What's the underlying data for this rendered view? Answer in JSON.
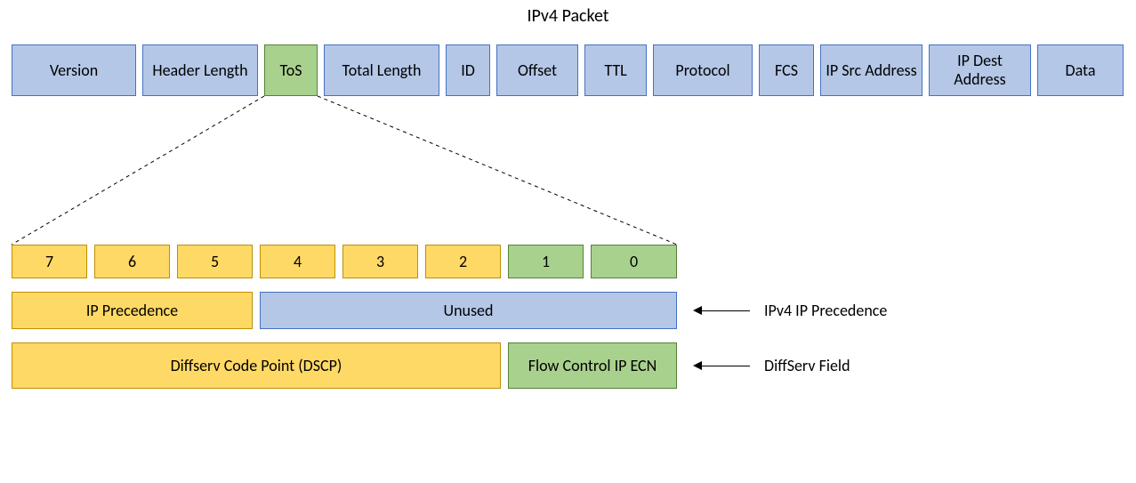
{
  "title": "IPv4 Packet",
  "header_fields": {
    "version": "Version",
    "header_length": "Header Length",
    "tos": "ToS",
    "total_length": "Total Length",
    "id": "ID",
    "offset": "Offset",
    "ttl": "TTL",
    "protocol": "Protocol",
    "fcs": "FCS",
    "ip_src_addr": "IP Src Address",
    "ip_dest_addr": "IP Dest Address",
    "data": "Data"
  },
  "bits": {
    "b7": "7",
    "b6": "6",
    "b5": "5",
    "b4": "4",
    "b3": "3",
    "b2": "2",
    "b1": "1",
    "b0": "0"
  },
  "precedence_row": {
    "ip_precedence": "IP Precedence",
    "unused": "Unused"
  },
  "diffserv_row": {
    "dscp": "Diffserv Code Point (DSCP)",
    "ecn": "Flow Control IP ECN"
  },
  "labels": {
    "ipv4_ip_precedence": "IPv4 IP Precedence",
    "diffserv_field": "DiffServ Field"
  }
}
